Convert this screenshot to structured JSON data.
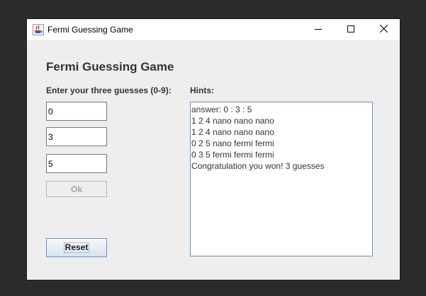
{
  "window": {
    "title": "Fermi Guessing Game",
    "controls": {
      "minimize_icon": "minimize-icon",
      "maximize_icon": "maximize-icon",
      "close_icon": "close-icon"
    }
  },
  "main": {
    "heading": "Fermi Guessing Game",
    "guesses_label": "Enter your three guesses (0-9):",
    "guesses": [
      "0",
      "3",
      "5"
    ],
    "ok_label": "Ok",
    "ok_enabled": false,
    "reset_label": "Reset",
    "hints_label": "Hints:",
    "hints": [
      "answer: 0 : 3 : 5",
      "1 2 4 nano nano nano",
      "1 2 4 nano nano nano",
      "0 2 5 nano fermi fermi",
      "0 3 5 fermi fermi fermi",
      "Congratulation you won! 3 guesses"
    ]
  },
  "colors": {
    "desktop": "#2b2b2b",
    "window_bg": "#eeeeee",
    "titlebar_bg": "#ffffff",
    "text": "#333333",
    "disabled_text": "#a3a3a3"
  }
}
